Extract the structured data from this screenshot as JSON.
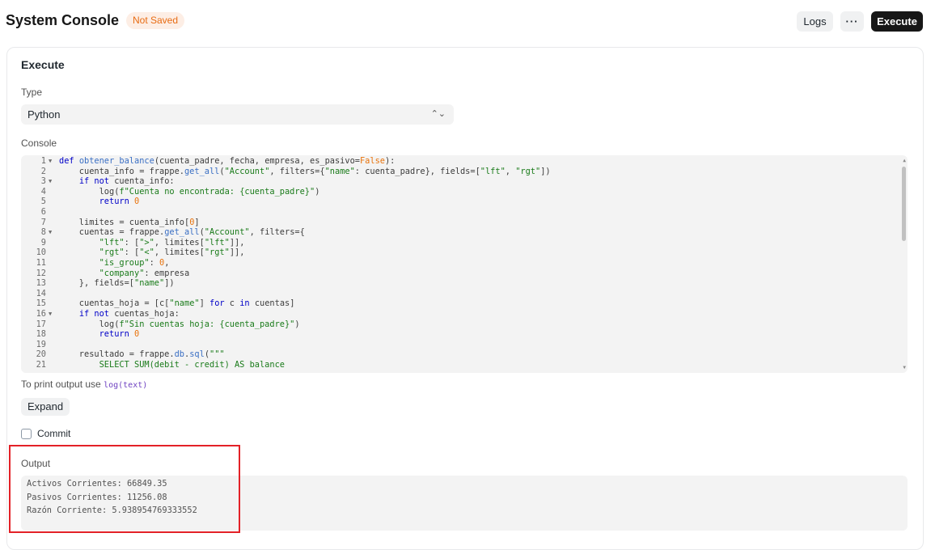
{
  "header": {
    "title": "System Console",
    "indicator": "Not Saved",
    "buttons": {
      "logs": "Logs",
      "more": "···",
      "execute": "Execute"
    }
  },
  "execute_section": {
    "heading": "Execute",
    "type_label": "Type",
    "type_value": "Python",
    "console_label": "Console",
    "code_lines": [
      {
        "n": "1",
        "fold": true,
        "tokens": [
          [
            "kw",
            "def "
          ],
          [
            "fn",
            "obtener_balance"
          ],
          [
            "",
            "(cuenta_padre, fecha, empresa, es_pasivo="
          ],
          [
            "num",
            "False"
          ],
          [
            "",
            "):"
          ]
        ]
      },
      {
        "n": "2",
        "fold": false,
        "tokens": [
          [
            "",
            "    cuenta_info = frappe."
          ],
          [
            "fn",
            "get_all"
          ],
          [
            "",
            "("
          ],
          [
            "str",
            "\"Account\""
          ],
          [
            "",
            ", filters={"
          ],
          [
            "str",
            "\"name\""
          ],
          [
            "",
            ": cuenta_padre}, fields=["
          ],
          [
            "str",
            "\"lft\""
          ],
          [
            "",
            ", "
          ],
          [
            "str",
            "\"rgt\""
          ],
          [
            "",
            "])"
          ]
        ]
      },
      {
        "n": "3",
        "fold": true,
        "tokens": [
          [
            "",
            "    "
          ],
          [
            "kw",
            "if not"
          ],
          [
            "",
            " cuenta_info:"
          ]
        ]
      },
      {
        "n": "4",
        "fold": false,
        "tokens": [
          [
            "",
            "        log("
          ],
          [
            "str",
            "f\"Cuenta no encontrada: {cuenta_padre}\""
          ],
          [
            "",
            ")"
          ]
        ]
      },
      {
        "n": "5",
        "fold": false,
        "tokens": [
          [
            "",
            "        "
          ],
          [
            "kw",
            "return "
          ],
          [
            "num",
            "0"
          ]
        ]
      },
      {
        "n": "6",
        "fold": false,
        "tokens": [
          [
            "",
            ""
          ]
        ]
      },
      {
        "n": "7",
        "fold": false,
        "tokens": [
          [
            "",
            "    limites = cuenta_info["
          ],
          [
            "num",
            "0"
          ],
          [
            "",
            "]"
          ]
        ]
      },
      {
        "n": "8",
        "fold": true,
        "tokens": [
          [
            "",
            "    cuentas = frappe."
          ],
          [
            "fn",
            "get_all"
          ],
          [
            "",
            "("
          ],
          [
            "str",
            "\"Account\""
          ],
          [
            "",
            ", filters={"
          ]
        ]
      },
      {
        "n": "9",
        "fold": false,
        "tokens": [
          [
            "",
            "        "
          ],
          [
            "str",
            "\"lft\""
          ],
          [
            "",
            ": ["
          ],
          [
            "str",
            "\">\""
          ],
          [
            "",
            ", limites["
          ],
          [
            "str",
            "\"lft\""
          ],
          [
            "",
            "]],"
          ]
        ]
      },
      {
        "n": "10",
        "fold": false,
        "tokens": [
          [
            "",
            "        "
          ],
          [
            "str",
            "\"rgt\""
          ],
          [
            "",
            ": ["
          ],
          [
            "str",
            "\"<\""
          ],
          [
            "",
            ", limites["
          ],
          [
            "str",
            "\"rgt\""
          ],
          [
            "",
            "]],"
          ]
        ]
      },
      {
        "n": "11",
        "fold": false,
        "tokens": [
          [
            "",
            "        "
          ],
          [
            "str",
            "\"is_group\""
          ],
          [
            "",
            ": "
          ],
          [
            "num",
            "0"
          ],
          [
            "",
            ","
          ]
        ]
      },
      {
        "n": "12",
        "fold": false,
        "tokens": [
          [
            "",
            "        "
          ],
          [
            "str",
            "\"company\""
          ],
          [
            "",
            ": empresa"
          ]
        ]
      },
      {
        "n": "13",
        "fold": false,
        "tokens": [
          [
            "",
            "    }, fields=["
          ],
          [
            "str",
            "\"name\""
          ],
          [
            "",
            "])"
          ]
        ]
      },
      {
        "n": "14",
        "fold": false,
        "tokens": [
          [
            "",
            ""
          ]
        ]
      },
      {
        "n": "15",
        "fold": false,
        "tokens": [
          [
            "",
            "    cuentas_hoja = [c["
          ],
          [
            "str",
            "\"name\""
          ],
          [
            "",
            "] "
          ],
          [
            "kw",
            "for"
          ],
          [
            "",
            " c "
          ],
          [
            "kw",
            "in"
          ],
          [
            "",
            " cuentas]"
          ]
        ]
      },
      {
        "n": "16",
        "fold": true,
        "tokens": [
          [
            "",
            "    "
          ],
          [
            "kw",
            "if not"
          ],
          [
            "",
            " cuentas_hoja:"
          ]
        ]
      },
      {
        "n": "17",
        "fold": false,
        "tokens": [
          [
            "",
            "        log("
          ],
          [
            "str",
            "f\"Sin cuentas hoja: {cuenta_padre}\""
          ],
          [
            "",
            ")"
          ]
        ]
      },
      {
        "n": "18",
        "fold": false,
        "tokens": [
          [
            "",
            "        "
          ],
          [
            "kw",
            "return "
          ],
          [
            "num",
            "0"
          ]
        ]
      },
      {
        "n": "19",
        "fold": false,
        "tokens": [
          [
            "",
            ""
          ]
        ]
      },
      {
        "n": "20",
        "fold": false,
        "tokens": [
          [
            "",
            "    resultado = frappe."
          ],
          [
            "fn",
            "db"
          ],
          [
            "",
            "."
          ],
          [
            "fn",
            "sql"
          ],
          [
            "",
            "("
          ],
          [
            "str",
            "\"\"\""
          ]
        ]
      },
      {
        "n": "21",
        "fold": false,
        "tokens": [
          [
            "str",
            "        SELECT SUM(debit - credit) AS balance"
          ]
        ]
      }
    ],
    "hint_text": "To print output use ",
    "hint_code": "log(text)",
    "expand_label": "Expand",
    "commit_label": "Commit",
    "commit_checked": false
  },
  "output": {
    "label": "Output",
    "lines": [
      "Activos Corrientes: 66849.35",
      "Pasivos Corrientes: 11256.08",
      "Razón Corriente: 5.938954769333552"
    ]
  },
  "colors": {
    "accent_dark": "#171717",
    "indicator_bg": "#fdeee5",
    "indicator_text": "#e86c13",
    "highlight": "#e32127"
  }
}
